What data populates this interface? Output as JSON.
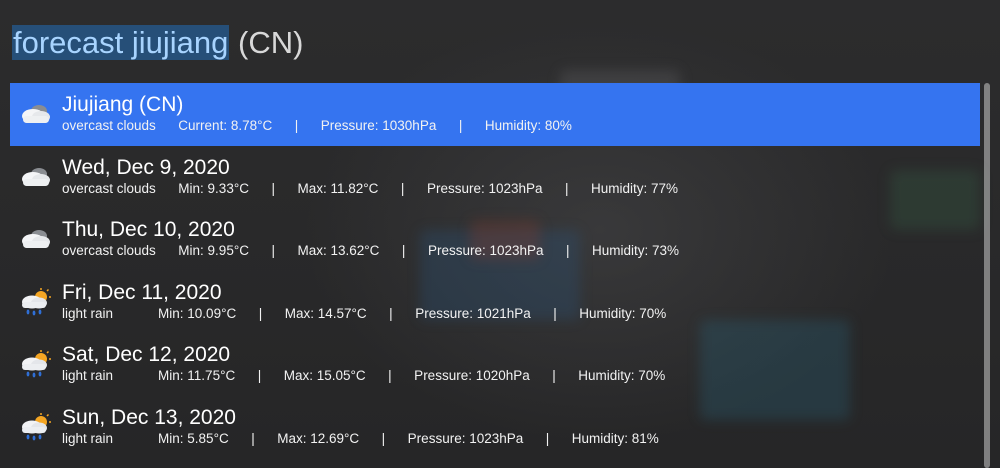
{
  "search": {
    "selected_text": "forecast jiujiang",
    "rest_text": " (CN)"
  },
  "results": [
    {
      "title": "Jiujiang (CN)",
      "icon": "overcast-clouds-icon",
      "selected": true,
      "details": "overcast clouds      Current: 8.78°C      |      Pressure: 1030hPa      |      Humidity: 80%"
    },
    {
      "title": "Wed, Dec 9, 2020",
      "icon": "overcast-clouds-icon",
      "selected": false,
      "details": "overcast clouds      Min: 9.33°C      |      Max: 11.82°C      |      Pressure: 1023hPa      |      Humidity: 77%"
    },
    {
      "title": "Thu, Dec 10, 2020",
      "icon": "overcast-clouds-icon",
      "selected": false,
      "details": "overcast clouds      Min: 9.95°C      |      Max: 13.62°C      |      Pressure: 1023hPa      |      Humidity: 73%"
    },
    {
      "title": "Fri, Dec 11, 2020",
      "icon": "light-rain-icon",
      "selected": false,
      "details": "light rain            Min: 10.09°C      |      Max: 14.57°C      |      Pressure: 1021hPa      |      Humidity: 70%"
    },
    {
      "title": "Sat, Dec 12, 2020",
      "icon": "light-rain-icon",
      "selected": false,
      "details": "light rain            Min: 11.75°C      |      Max: 15.05°C      |      Pressure: 1020hPa      |      Humidity: 70%"
    },
    {
      "title": "Sun, Dec 13, 2020",
      "icon": "light-rain-icon",
      "selected": false,
      "details": "light rain            Min: 5.85°C      |      Max: 12.69°C      |      Pressure: 1023hPa      |      Humidity: 81%"
    }
  ],
  "colors": {
    "selection_blue": "#3574f0",
    "search_highlight": "#264f78"
  }
}
